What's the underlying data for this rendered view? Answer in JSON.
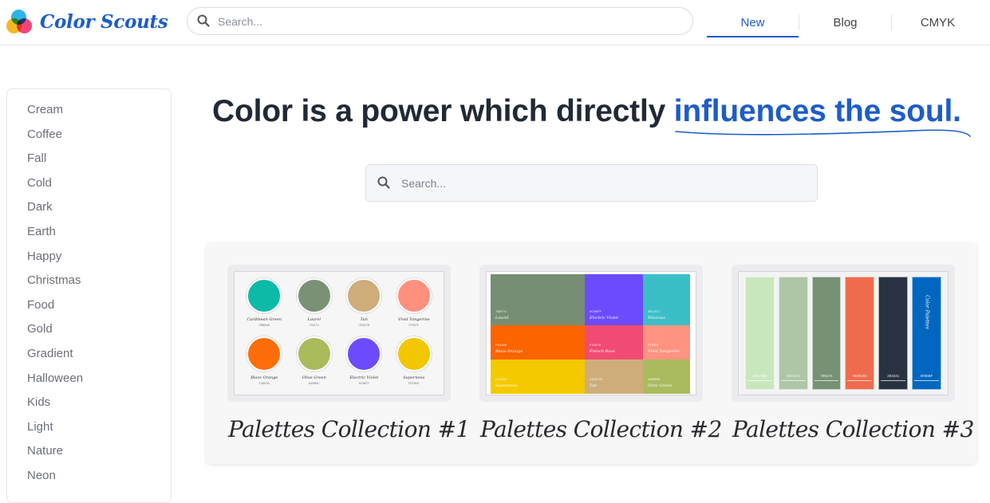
{
  "app": {
    "name": "Color Scouts",
    "logo_colors": [
      "#f5b820",
      "#f2447a",
      "#2db4e6"
    ]
  },
  "header": {
    "search_placeholder": "Search...",
    "nav": [
      {
        "label": "New",
        "active": true
      },
      {
        "label": "Blog",
        "active": false
      },
      {
        "label": "CMYK",
        "active": false
      }
    ]
  },
  "sidebar": {
    "items": [
      {
        "label": "Cream"
      },
      {
        "label": "Coffee"
      },
      {
        "label": "Fall"
      },
      {
        "label": "Cold"
      },
      {
        "label": "Dark"
      },
      {
        "label": "Earth"
      },
      {
        "label": "Happy"
      },
      {
        "label": "Christmas"
      },
      {
        "label": "Food"
      },
      {
        "label": "Gold"
      },
      {
        "label": "Gradient"
      },
      {
        "label": "Halloween"
      },
      {
        "label": "Kids"
      },
      {
        "label": "Light"
      },
      {
        "label": "Nature"
      },
      {
        "label": "Neon"
      }
    ]
  },
  "hero": {
    "headline_plain": "Color is a power which directly",
    "headline_highlight": "influences the soul.",
    "search_placeholder": "Search...",
    "accent": "#1e5cc8"
  },
  "collections": [
    {
      "title": "Palettes Collection #1",
      "swatches": [
        {
          "name": "Caribbean Green",
          "hex": "0BBBA8",
          "color": "#0bbba8"
        },
        {
          "name": "Laurel",
          "hex": "7A9174",
          "color": "#7a9174"
        },
        {
          "name": "Tan",
          "hex": "CEAD7B",
          "color": "#cead7b"
        },
        {
          "name": "Vivid Tangerine",
          "hex": "FF907E",
          "color": "#ff907e"
        },
        {
          "name": "Blaze Orange",
          "hex": "FC6E0A",
          "color": "#fc6e0a"
        },
        {
          "name": "Olive Green",
          "hex": "AABB5C",
          "color": "#aabb5c"
        },
        {
          "name": "Electric Violet",
          "hex": "6C4BFF",
          "color": "#6c4bff"
        },
        {
          "name": "Supernova",
          "hex": "FECB00",
          "color": "#f2c600"
        }
      ]
    },
    {
      "title": "Palettes Collection #2",
      "blocks": [
        {
          "name": "Laurel",
          "hex": "768F74",
          "color": "#768f74"
        },
        {
          "name": "Electric Violet",
          "hex": "6C4BFF",
          "color": "#6c4bff"
        },
        {
          "name": "Pelorous",
          "hex": "3BC0C7",
          "color": "#3bbfc7"
        },
        {
          "name": "Blaze Orange",
          "hex": "FE6300",
          "color": "#fc6400"
        },
        {
          "name": "French Rose",
          "hex": "F24A78",
          "color": "#f14b73"
        },
        {
          "name": "Vivid Tangerine",
          "hex": "FF9381",
          "color": "#ff9381"
        },
        {
          "name": "Supernova",
          "hex": "F5C900",
          "color": "#f5c900"
        },
        {
          "name": "Tan",
          "hex": "CEAD7B",
          "color": "#cead7b"
        },
        {
          "name": "Olive Green",
          "hex": "AABB5E",
          "color": "#aabb5e"
        }
      ]
    },
    {
      "title": "Palettes Collection #3",
      "bars": [
        {
          "hex": "C8EABD",
          "color": "#c8e7bd"
        },
        {
          "hex": "AEC6A5",
          "color": "#aec6a5"
        },
        {
          "hex": "769174",
          "color": "#769174"
        },
        {
          "hex": "EE6C4D",
          "color": "#ee6c4d"
        },
        {
          "hex": "293241",
          "color": "#293241"
        },
        {
          "hex": "0066BF",
          "color": "#0066bf",
          "label": "Color Palettes"
        }
      ]
    }
  ]
}
